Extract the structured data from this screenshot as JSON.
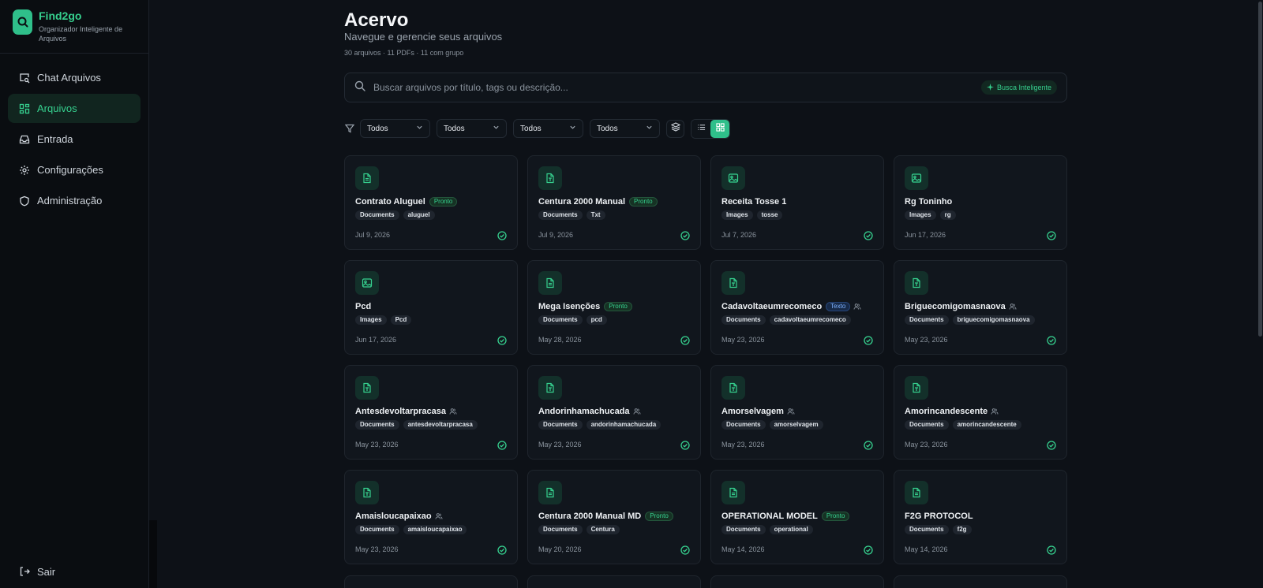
{
  "brand": {
    "name": "Find2go",
    "subtitle": "Organizador Inteligente de Arquivos"
  },
  "nav": [
    {
      "label": "Chat Arquivos",
      "icon": "chat-search-icon",
      "active": false
    },
    {
      "label": "Arquivos",
      "icon": "grid-icon",
      "active": true
    },
    {
      "label": "Entrada",
      "icon": "inbox-icon",
      "active": false
    },
    {
      "label": "Configurações",
      "icon": "gear-icon",
      "active": false
    },
    {
      "label": "Administração",
      "icon": "shield-icon",
      "active": false
    }
  ],
  "footer": {
    "logout_label": "Sair"
  },
  "page": {
    "title": "Acervo",
    "subtitle": "Navegue e gerencie seus arquivos",
    "stats": "30 arquivos · 11 PDFs · 11 com grupo"
  },
  "search": {
    "placeholder": "Buscar arquivos por título, tags ou descrição...",
    "value": "",
    "smart_label": "Busca Inteligente"
  },
  "filters": {
    "selects": [
      "Todos",
      "Todos",
      "Todos",
      "Todos"
    ]
  },
  "colors": {
    "accent": "#2fbf8a",
    "background": "#0d1117",
    "card": "#11161d"
  },
  "cards": [
    {
      "title": "Contrato Aluguel",
      "badge": "Pronto",
      "badge_color": "green",
      "group": false,
      "type": "doc",
      "tags": [
        "Documents",
        "aluguel"
      ],
      "date": "Jul 9, 2026"
    },
    {
      "title": "Centura 2000 Manual",
      "badge": "Pronto",
      "badge_color": "green",
      "group": false,
      "type": "txt",
      "tags": [
        "Documents",
        "Txt"
      ],
      "date": "Jul 9, 2026"
    },
    {
      "title": "Receita Tosse 1",
      "badge": "",
      "badge_color": "",
      "group": false,
      "type": "image",
      "tags": [
        "Images",
        "tosse"
      ],
      "date": "Jul 7, 2026"
    },
    {
      "title": "Rg Toninho",
      "badge": "",
      "badge_color": "",
      "group": false,
      "type": "image",
      "tags": [
        "Images",
        "rg"
      ],
      "date": "Jun 17, 2026"
    },
    {
      "title": "Pcd",
      "badge": "",
      "badge_color": "",
      "group": false,
      "type": "image",
      "tags": [
        "Images",
        "Pcd"
      ],
      "date": "Jun 17, 2026"
    },
    {
      "title": "Mega Isenções",
      "badge": "Pronto",
      "badge_color": "green",
      "group": false,
      "type": "doc",
      "tags": [
        "Documents",
        "pcd"
      ],
      "date": "May 28, 2026"
    },
    {
      "title": "Cadavoltaeumrecomeco",
      "badge": "Texto",
      "badge_color": "blue",
      "group": true,
      "type": "txt",
      "tags": [
        "Documents",
        "cadavoltaeumrecomeco"
      ],
      "date": "May 23, 2026"
    },
    {
      "title": "Briguecomigomasnaova",
      "badge": "",
      "badge_color": "",
      "group": true,
      "type": "txt",
      "tags": [
        "Documents",
        "briguecomigomasnaova"
      ],
      "date": "May 23, 2026"
    },
    {
      "title": "Antesdevoltarpracasa",
      "badge": "",
      "badge_color": "",
      "group": true,
      "type": "txt",
      "tags": [
        "Documents",
        "antesdevoltarpracasa"
      ],
      "date": "May 23, 2026"
    },
    {
      "title": "Andorinhamachucada",
      "badge": "",
      "badge_color": "",
      "group": true,
      "type": "txt",
      "tags": [
        "Documents",
        "andorinhamachucada"
      ],
      "date": "May 23, 2026"
    },
    {
      "title": "Amorselvagem",
      "badge": "",
      "badge_color": "",
      "group": true,
      "type": "txt",
      "tags": [
        "Documents",
        "amorselvagem"
      ],
      "date": "May 23, 2026"
    },
    {
      "title": "Amorincandescente",
      "badge": "",
      "badge_color": "",
      "group": true,
      "type": "txt",
      "tags": [
        "Documents",
        "amorincandescente"
      ],
      "date": "May 23, 2026"
    },
    {
      "title": "Amaisloucapaixao",
      "badge": "",
      "badge_color": "",
      "group": true,
      "type": "txt",
      "tags": [
        "Documents",
        "amaisloucapaixao"
      ],
      "date": "May 23, 2026"
    },
    {
      "title": "Centura 2000 Manual MD",
      "badge": "Pronto",
      "badge_color": "green",
      "group": false,
      "type": "doc",
      "tags": [
        "Documents",
        "Centura"
      ],
      "date": "May 20, 2026"
    },
    {
      "title": "OPERATIONAL MODEL",
      "badge": "Pronto",
      "badge_color": "green",
      "group": false,
      "type": "doc",
      "tags": [
        "Documents",
        "operational"
      ],
      "date": "May 14, 2026"
    },
    {
      "title": "F2G PROTOCOL",
      "badge": "",
      "badge_color": "",
      "group": false,
      "type": "doc",
      "tags": [
        "Documents",
        "f2g"
      ],
      "date": "May 14, 2026"
    }
  ]
}
